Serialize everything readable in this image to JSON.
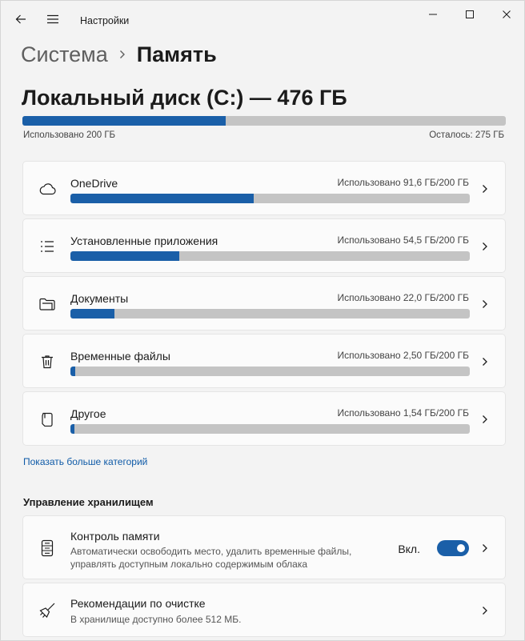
{
  "window": {
    "title": "Настройки"
  },
  "breadcrumb": {
    "parent": "Система",
    "current": "Память"
  },
  "disk": {
    "title": "Локальный диск (C:) — 476 ГБ",
    "used_label": "Использовано 200 ГБ",
    "left_label": "Осталось: 275 ГБ",
    "used_fraction": 0.42
  },
  "categories": [
    {
      "name": "OneDrive",
      "usage": "Использовано 91,6 ГБ/200 ГБ",
      "fraction": 0.458,
      "icon": "cloud-icon"
    },
    {
      "name": "Установленные приложения",
      "usage": "Использовано 54,5 ГБ/200 ГБ",
      "fraction": 0.2725,
      "icon": "app-list-icon"
    },
    {
      "name": "Документы",
      "usage": "Использовано 22,0 ГБ/200 ГБ",
      "fraction": 0.11,
      "icon": "folder-icon"
    },
    {
      "name": "Временные файлы",
      "usage": "Использовано 2,50 ГБ/200 ГБ",
      "fraction": 0.0125,
      "icon": "trash-icon"
    },
    {
      "name": "Другое",
      "usage": "Использовано 1,54 ГБ/200 ГБ",
      "fraction": 0.0077,
      "icon": "other-files-icon"
    }
  ],
  "more_categories_link": "Показать больше категорий",
  "management": {
    "title": "Управление хранилищем",
    "storage_sense": {
      "name": "Контроль памяти",
      "desc_line1": "Автоматически освободить место, удалить временные файлы,",
      "desc_line2": "управлять доступным локально содержимым облака",
      "toggle_label": "Вкл.",
      "toggle_on": true,
      "icon": "storage-drive-icon"
    },
    "cleanup": {
      "name": "Рекомендации по очистке",
      "desc": "В хранилище доступно более 512 МБ.",
      "icon": "broom-icon"
    }
  },
  "colors": {
    "accent": "#1a5fa8",
    "bar_track": "#c4c4c4",
    "link": "#0e5aa7"
  }
}
